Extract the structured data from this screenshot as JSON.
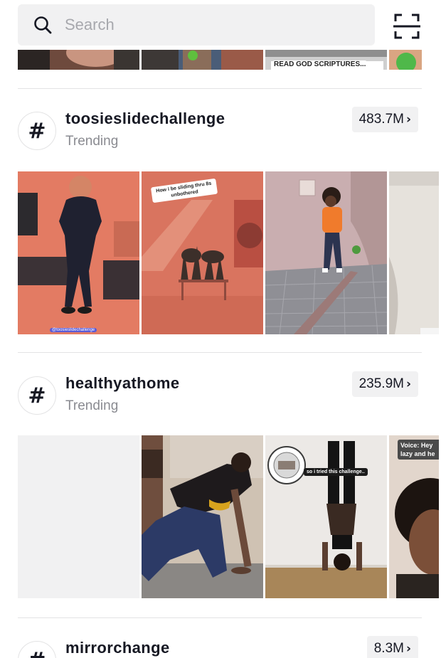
{
  "search": {
    "placeholder": "Search",
    "icon": "search-icon",
    "scan_icon": "scan-icon"
  },
  "top_strip": {
    "captions": [
      "READ GOD SCRIPTURES..."
    ]
  },
  "hashtags": [
    {
      "name": "toosieslidechallenge",
      "subtitle": "Trending",
      "count": "483.7M",
      "thumbnails": [
        {
          "caption": "@toosieslidechallenge"
        },
        {
          "caption": "How i be sliding thru 8s unbothered"
        },
        {
          "caption": ""
        },
        {
          "caption": ""
        }
      ]
    },
    {
      "name": "healthyathome",
      "subtitle": "Trending",
      "count": "235.9M",
      "thumbnails": [
        {
          "caption": ""
        },
        {
          "caption": ""
        },
        {
          "caption": "so i tried this challenge.."
        },
        {
          "caption": "Voice: Hey lazy and he"
        }
      ]
    },
    {
      "name": "mirrorchange",
      "subtitle": "",
      "count": "8.3M",
      "thumbnails": []
    }
  ],
  "colors": {
    "bar_bg": "#f1f1f2",
    "text_primary": "#161823",
    "text_secondary": "#8a8b91",
    "divider": "#e3e3e4"
  }
}
